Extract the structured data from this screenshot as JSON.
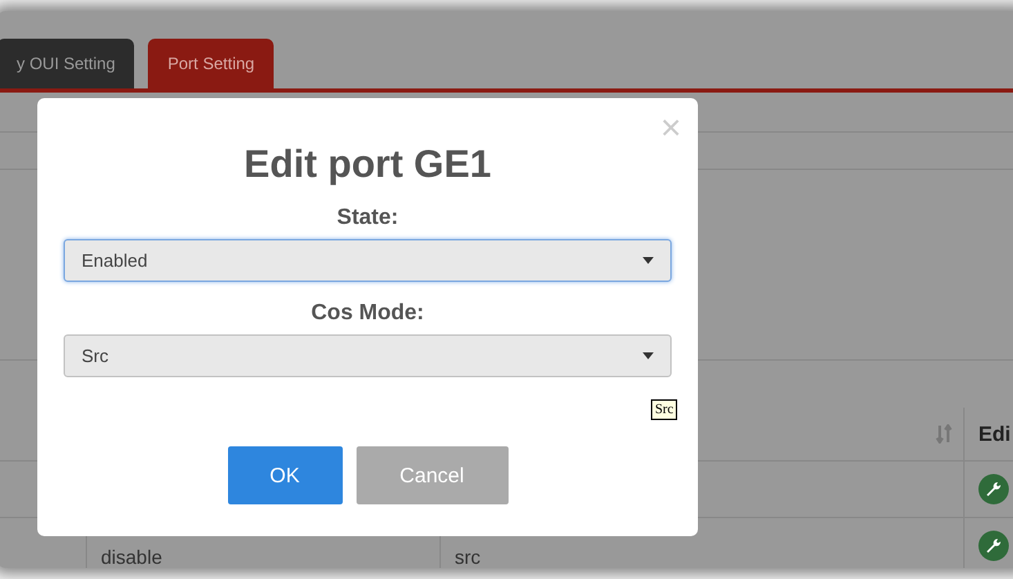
{
  "tabs": [
    {
      "label": "y OUI Setting",
      "selected": false
    },
    {
      "label": "Port Setting",
      "selected": true
    }
  ],
  "table": {
    "edit_header": "Edi",
    "rows": [
      {},
      {
        "column_2": "disable",
        "column_3": "src"
      }
    ]
  },
  "dialog": {
    "close": "×",
    "title": "Edit port GE1",
    "fields": [
      {
        "label": "State:",
        "value": "Enabled",
        "focused": true
      },
      {
        "label": "Cos Mode:",
        "value": "Src",
        "focused": false
      }
    ],
    "tooltip": "Src",
    "buttons": [
      {
        "label": "OK",
        "kind": "primary"
      },
      {
        "label": "Cancel",
        "kind": "secondary"
      }
    ]
  }
}
